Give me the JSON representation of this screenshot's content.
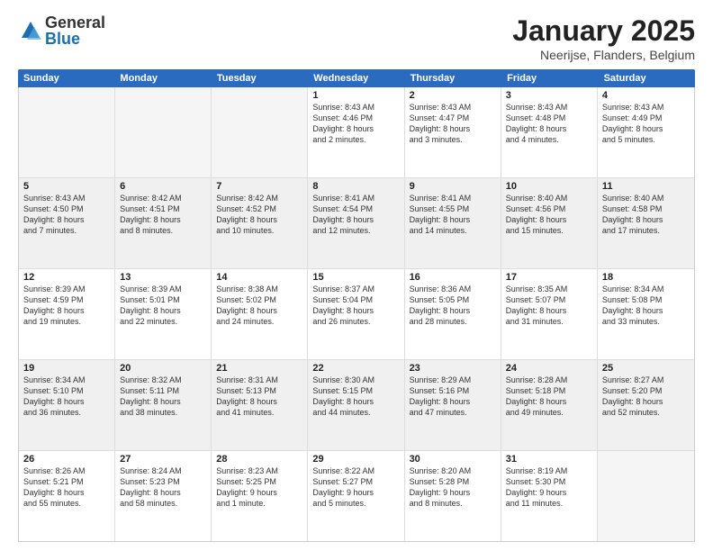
{
  "logo": {
    "general": "General",
    "blue": "Blue"
  },
  "header": {
    "title": "January 2025",
    "subtitle": "Neerijse, Flanders, Belgium"
  },
  "weekdays": [
    "Sunday",
    "Monday",
    "Tuesday",
    "Wednesday",
    "Thursday",
    "Friday",
    "Saturday"
  ],
  "weeks": [
    [
      {
        "day": "",
        "info": "",
        "empty": true
      },
      {
        "day": "",
        "info": "",
        "empty": true
      },
      {
        "day": "",
        "info": "",
        "empty": true
      },
      {
        "day": "1",
        "info": "Sunrise: 8:43 AM\nSunset: 4:46 PM\nDaylight: 8 hours\nand 2 minutes."
      },
      {
        "day": "2",
        "info": "Sunrise: 8:43 AM\nSunset: 4:47 PM\nDaylight: 8 hours\nand 3 minutes."
      },
      {
        "day": "3",
        "info": "Sunrise: 8:43 AM\nSunset: 4:48 PM\nDaylight: 8 hours\nand 4 minutes."
      },
      {
        "day": "4",
        "info": "Sunrise: 8:43 AM\nSunset: 4:49 PM\nDaylight: 8 hours\nand 5 minutes."
      }
    ],
    [
      {
        "day": "5",
        "info": "Sunrise: 8:43 AM\nSunset: 4:50 PM\nDaylight: 8 hours\nand 7 minutes."
      },
      {
        "day": "6",
        "info": "Sunrise: 8:42 AM\nSunset: 4:51 PM\nDaylight: 8 hours\nand 8 minutes."
      },
      {
        "day": "7",
        "info": "Sunrise: 8:42 AM\nSunset: 4:52 PM\nDaylight: 8 hours\nand 10 minutes."
      },
      {
        "day": "8",
        "info": "Sunrise: 8:41 AM\nSunset: 4:54 PM\nDaylight: 8 hours\nand 12 minutes."
      },
      {
        "day": "9",
        "info": "Sunrise: 8:41 AM\nSunset: 4:55 PM\nDaylight: 8 hours\nand 14 minutes."
      },
      {
        "day": "10",
        "info": "Sunrise: 8:40 AM\nSunset: 4:56 PM\nDaylight: 8 hours\nand 15 minutes."
      },
      {
        "day": "11",
        "info": "Sunrise: 8:40 AM\nSunset: 4:58 PM\nDaylight: 8 hours\nand 17 minutes."
      }
    ],
    [
      {
        "day": "12",
        "info": "Sunrise: 8:39 AM\nSunset: 4:59 PM\nDaylight: 8 hours\nand 19 minutes."
      },
      {
        "day": "13",
        "info": "Sunrise: 8:39 AM\nSunset: 5:01 PM\nDaylight: 8 hours\nand 22 minutes."
      },
      {
        "day": "14",
        "info": "Sunrise: 8:38 AM\nSunset: 5:02 PM\nDaylight: 8 hours\nand 24 minutes."
      },
      {
        "day": "15",
        "info": "Sunrise: 8:37 AM\nSunset: 5:04 PM\nDaylight: 8 hours\nand 26 minutes."
      },
      {
        "day": "16",
        "info": "Sunrise: 8:36 AM\nSunset: 5:05 PM\nDaylight: 8 hours\nand 28 minutes."
      },
      {
        "day": "17",
        "info": "Sunrise: 8:35 AM\nSunset: 5:07 PM\nDaylight: 8 hours\nand 31 minutes."
      },
      {
        "day": "18",
        "info": "Sunrise: 8:34 AM\nSunset: 5:08 PM\nDaylight: 8 hours\nand 33 minutes."
      }
    ],
    [
      {
        "day": "19",
        "info": "Sunrise: 8:34 AM\nSunset: 5:10 PM\nDaylight: 8 hours\nand 36 minutes."
      },
      {
        "day": "20",
        "info": "Sunrise: 8:32 AM\nSunset: 5:11 PM\nDaylight: 8 hours\nand 38 minutes."
      },
      {
        "day": "21",
        "info": "Sunrise: 8:31 AM\nSunset: 5:13 PM\nDaylight: 8 hours\nand 41 minutes."
      },
      {
        "day": "22",
        "info": "Sunrise: 8:30 AM\nSunset: 5:15 PM\nDaylight: 8 hours\nand 44 minutes."
      },
      {
        "day": "23",
        "info": "Sunrise: 8:29 AM\nSunset: 5:16 PM\nDaylight: 8 hours\nand 47 minutes."
      },
      {
        "day": "24",
        "info": "Sunrise: 8:28 AM\nSunset: 5:18 PM\nDaylight: 8 hours\nand 49 minutes."
      },
      {
        "day": "25",
        "info": "Sunrise: 8:27 AM\nSunset: 5:20 PM\nDaylight: 8 hours\nand 52 minutes."
      }
    ],
    [
      {
        "day": "26",
        "info": "Sunrise: 8:26 AM\nSunset: 5:21 PM\nDaylight: 8 hours\nand 55 minutes."
      },
      {
        "day": "27",
        "info": "Sunrise: 8:24 AM\nSunset: 5:23 PM\nDaylight: 8 hours\nand 58 minutes."
      },
      {
        "day": "28",
        "info": "Sunrise: 8:23 AM\nSunset: 5:25 PM\nDaylight: 9 hours\nand 1 minute."
      },
      {
        "day": "29",
        "info": "Sunrise: 8:22 AM\nSunset: 5:27 PM\nDaylight: 9 hours\nand 5 minutes."
      },
      {
        "day": "30",
        "info": "Sunrise: 8:20 AM\nSunset: 5:28 PM\nDaylight: 9 hours\nand 8 minutes."
      },
      {
        "day": "31",
        "info": "Sunrise: 8:19 AM\nSunset: 5:30 PM\nDaylight: 9 hours\nand 11 minutes."
      },
      {
        "day": "",
        "info": "",
        "empty": true
      }
    ]
  ]
}
